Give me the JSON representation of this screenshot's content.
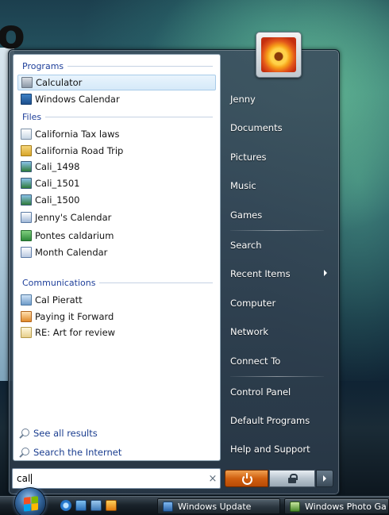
{
  "start_menu": {
    "left": {
      "sections": {
        "programs": "Programs",
        "files": "Files",
        "communications": "Communications"
      },
      "programs": [
        {
          "label": "Calculator",
          "icon": "calculator-icon",
          "selected": true
        },
        {
          "label": "Windows Calendar",
          "icon": "windows-calendar-icon"
        }
      ],
      "files": [
        {
          "label": "California Tax laws",
          "icon": "document-icon"
        },
        {
          "label": "California Road Trip",
          "icon": "folder-icon"
        },
        {
          "label": "Cali_1498",
          "icon": "image-icon"
        },
        {
          "label": "Cali_1501",
          "icon": "image-icon"
        },
        {
          "label": "Cali_1500",
          "icon": "image-icon"
        },
        {
          "label": "Jenny's Calendar",
          "icon": "calendar-file-icon"
        },
        {
          "label": "Pontes caldarium",
          "icon": "spreadsheet-icon"
        },
        {
          "label": "Month Calendar",
          "icon": "calendar-file-icon"
        }
      ],
      "communications": [
        {
          "label": "Cal Pieratt",
          "icon": "contact-icon"
        },
        {
          "label": "Paying it Forward",
          "icon": "presentation-icon"
        },
        {
          "label": "RE: Art for review",
          "icon": "mail-icon"
        }
      ],
      "see_all_results": "See all results",
      "search_internet": "Search the Internet"
    },
    "search": {
      "value": "cal",
      "clear_glyph": "×"
    },
    "right": {
      "items": [
        {
          "label": "Jenny"
        },
        {
          "label": "Documents"
        },
        {
          "label": "Pictures"
        },
        {
          "label": "Music"
        },
        {
          "label": "Games"
        },
        {
          "label": "Search"
        },
        {
          "label": "Recent Items",
          "has_submenu": true
        },
        {
          "label": "Computer"
        },
        {
          "label": "Network"
        },
        {
          "label": "Connect To"
        },
        {
          "label": "Control Panel"
        },
        {
          "label": "Default Programs"
        },
        {
          "label": "Help and Support"
        }
      ]
    },
    "power": {
      "power_icon": "power-icon",
      "lock_icon": "lock-icon",
      "more_icon": "chevron-right-icon"
    }
  },
  "taskbar": {
    "start_icon": "windows-start-orb-icon",
    "quick_launch": [
      "internet-explorer-icon",
      "show-desktop-icon",
      "switch-windows-icon",
      "media-player-icon"
    ],
    "tasks": [
      {
        "label": "Windows Update",
        "icon": "windows-update-icon"
      },
      {
        "label": "Windows Photo Ga",
        "icon": "photo-gallery-icon"
      }
    ]
  },
  "desktop": {
    "partial_title_glyph": "o"
  },
  "colors": {
    "accent_link": "#1e3f9a",
    "power_orange": "#d06010",
    "selected_item_bg": "#d5e9f8"
  }
}
